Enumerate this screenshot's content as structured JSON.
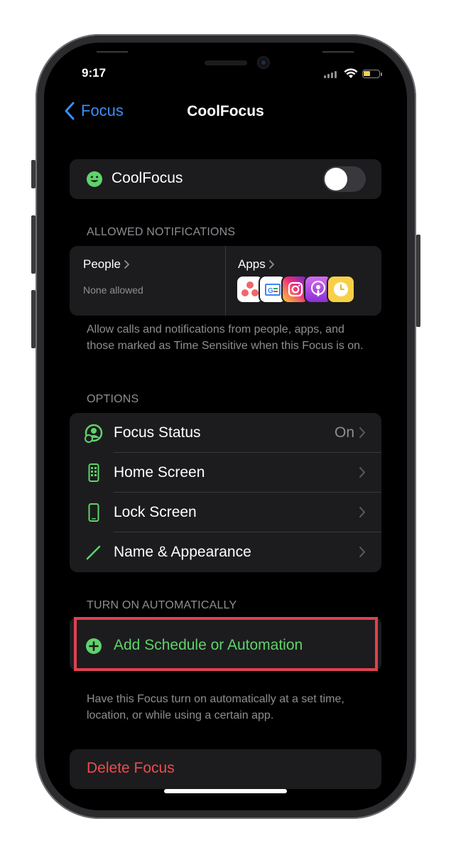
{
  "status_bar": {
    "time": "9:17"
  },
  "nav": {
    "back_label": "Focus",
    "title": "CoolFocus"
  },
  "focus_toggle": {
    "label": "CoolFocus",
    "state": "off"
  },
  "allowed_notifications": {
    "header": "ALLOWED NOTIFICATIONS",
    "people": {
      "title": "People",
      "subtitle": "None allowed"
    },
    "apps": {
      "title": "Apps",
      "icons": [
        "asana-icon",
        "google-news-icon",
        "instagram-icon",
        "podcasts-icon",
        "clock-icon"
      ]
    },
    "footnote": "Allow calls and notifications from people, apps, and those marked as Time Sensitive when this Focus is on."
  },
  "options": {
    "header": "OPTIONS",
    "items": [
      {
        "label": "Focus Status",
        "value": "On",
        "icon": "focus-status-icon"
      },
      {
        "label": "Home Screen",
        "value": "",
        "icon": "home-screen-icon"
      },
      {
        "label": "Lock Screen",
        "value": "",
        "icon": "lock-screen-icon"
      },
      {
        "label": "Name & Appearance",
        "value": "",
        "icon": "pencil-icon"
      }
    ]
  },
  "automation": {
    "header": "TURN ON AUTOMATICALLY",
    "add_label": "Add Schedule or Automation",
    "footnote": "Have this Focus turn on automatically at a set time, location, or while using a certain app."
  },
  "delete": {
    "label": "Delete Focus"
  },
  "colors": {
    "accent_blue": "#3c8ef5",
    "accent_green": "#5fd36a",
    "destructive_red": "#eb4d4d",
    "highlight_red": "#e0414f",
    "card_bg": "#1c1c1e"
  }
}
